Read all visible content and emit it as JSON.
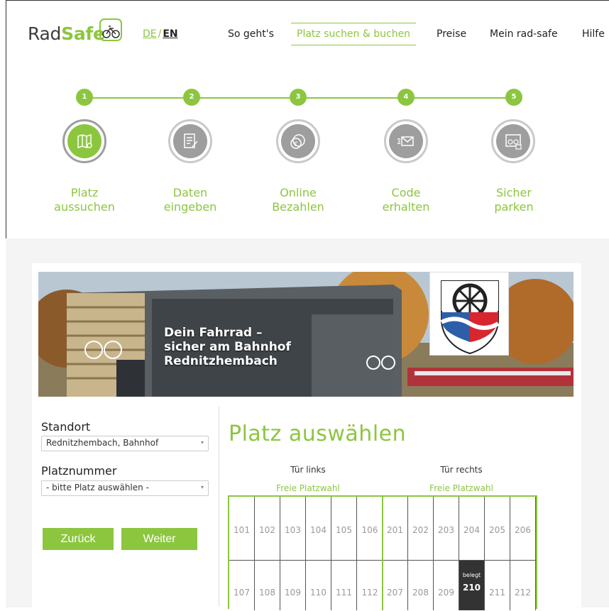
{
  "header": {
    "logo_part1": "Rad",
    "logo_part2": "Safe",
    "lang_de": "DE",
    "lang_sep": "/",
    "lang_en": "EN",
    "nav": [
      "So geht's",
      "Platz suchen & buchen",
      "Preise",
      "Mein rad-safe",
      "Hilfe"
    ]
  },
  "steps": [
    {
      "num": "1",
      "label1": "Platz",
      "label2": "aussuchen",
      "icon": "map-pin-icon"
    },
    {
      "num": "2",
      "label1": "Daten",
      "label2": "eingeben",
      "icon": "form-edit-icon"
    },
    {
      "num": "3",
      "label1": "Online",
      "label2": "Bezahlen",
      "icon": "euro-coin-icon"
    },
    {
      "num": "4",
      "label1": "Code",
      "label2": "erhalten",
      "icon": "envelope-icon"
    },
    {
      "num": "5",
      "label1": "Sicher",
      "label2": "parken",
      "icon": "bike-lock-icon"
    }
  ],
  "banner": {
    "line1": "Dein Fahrrad –",
    "line2": "sicher am Bahnhof",
    "line3": "Rednitzhembach"
  },
  "form": {
    "standort_label": "Standort",
    "standort_value": "Rednitzhembach, Bahnhof",
    "platz_label": "Platznummer",
    "platz_value": "- bitte Platz auswählen -",
    "back": "Zurück",
    "next": "Weiter"
  },
  "grid": {
    "title": "Platz auswählen",
    "door_left": "Tür links",
    "door_right": "Tür rechts",
    "free_left": "Freie Platzwahl",
    "free_right": "Freie Platzwahl",
    "row1": [
      "101",
      "102",
      "103",
      "104",
      "105",
      "106",
      "201",
      "202",
      "203",
      "204",
      "205",
      "206"
    ],
    "row2": [
      "107",
      "108",
      "109",
      "110",
      "111",
      "112",
      "207",
      "208",
      "209",
      "210",
      "211",
      "212"
    ],
    "occupied_label": "belegt",
    "occupied_slot": "210"
  },
  "colors": {
    "accent": "#8cc63f",
    "gray_icon": "#9e9e9e",
    "occupied": "#333333"
  }
}
